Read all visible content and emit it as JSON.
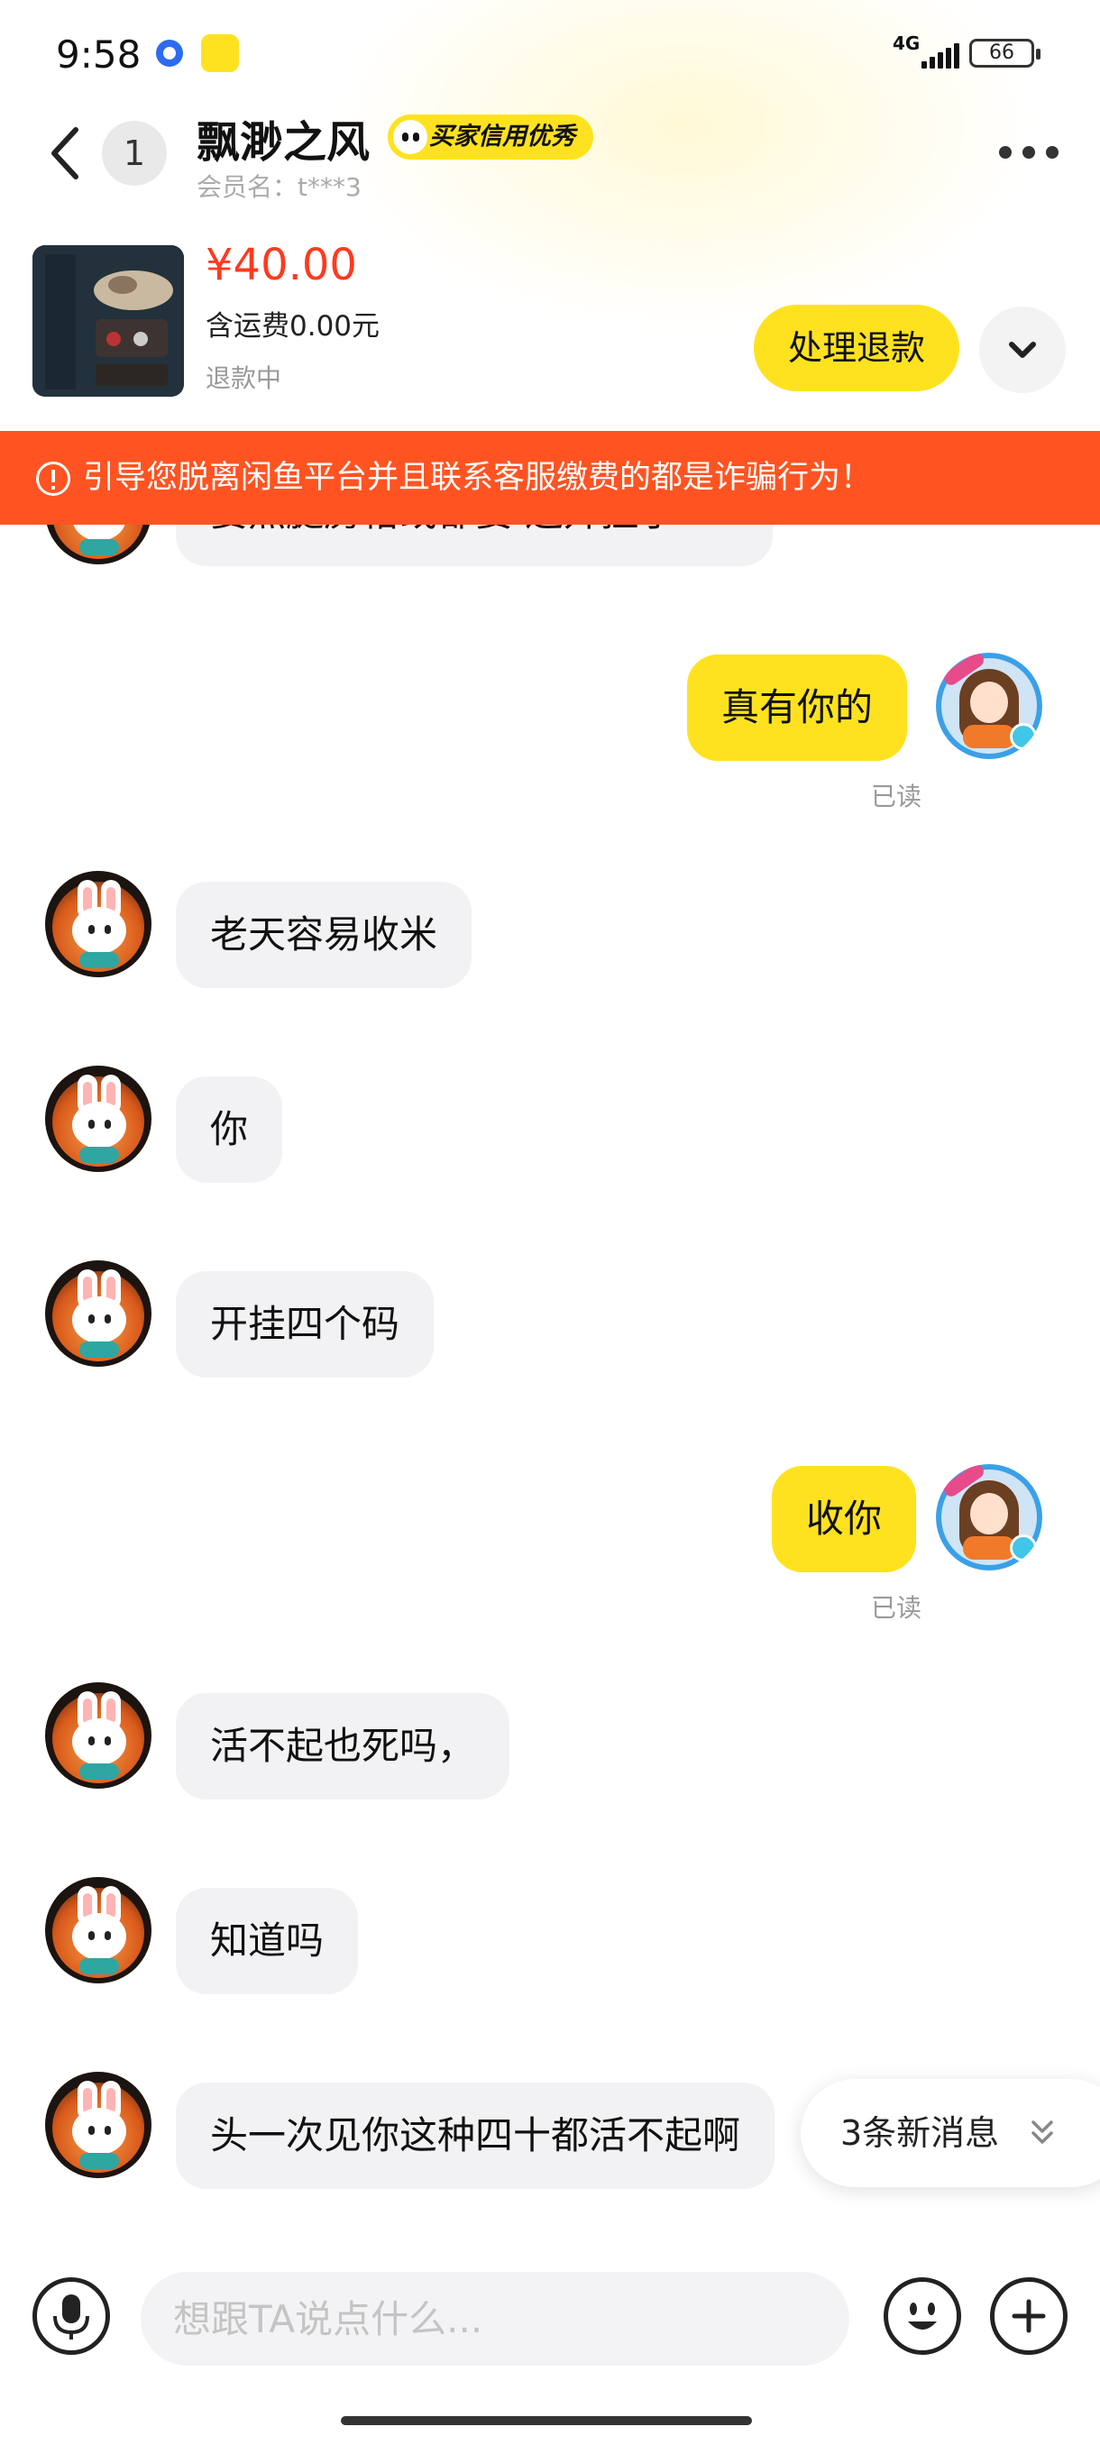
{
  "status_bar": {
    "time": "9:58",
    "network": "4G",
    "battery": "66"
  },
  "header": {
    "unread_count": "1",
    "nickname": "飘渺之风",
    "credit_badge": "买家信用优秀",
    "member_name": "会员名：t***3"
  },
  "product": {
    "price": "¥40.00",
    "shipping": "含运费0.00元",
    "status": "退款中",
    "refund_button": "处理退款"
  },
  "warning": {
    "text": "引导您脱离闲鱼平台并且联系客服缴费的都是诈骗行为！"
  },
  "messages": [
    {
      "text": "要照腿房格或都要 还开挂了"
    },
    {
      "text": "真有你的",
      "status": "已读"
    },
    {
      "text": "老天容易收米"
    },
    {
      "text": "你"
    },
    {
      "text": "开挂四个码"
    },
    {
      "text": "收你",
      "status": "已读"
    },
    {
      "text": "活不起也死吗，"
    },
    {
      "text": "知道吗"
    },
    {
      "text": "头一次见你这种四十都活不起啊"
    }
  ],
  "new_messages": {
    "label": "3条新消息"
  },
  "input": {
    "placeholder": "想跟TA说点什么..."
  },
  "colors": {
    "accent": "#ffe21f",
    "warning": "#ff5422",
    "price": "#ff3a1f"
  }
}
